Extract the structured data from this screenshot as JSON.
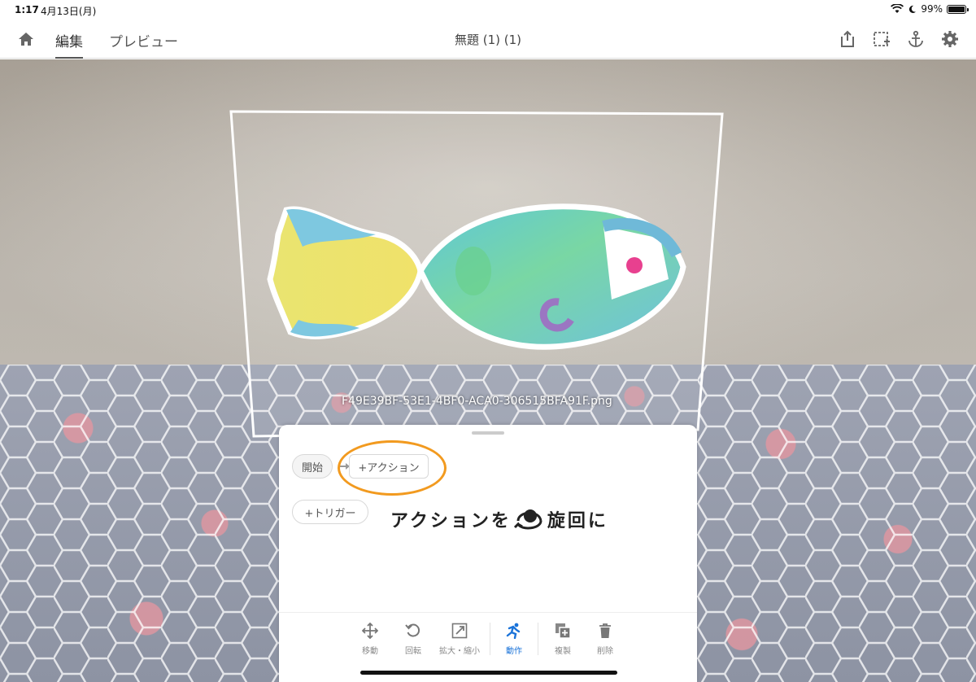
{
  "status_bar": {
    "time": "1:17",
    "date": "4月13日(月)",
    "battery": "99%",
    "battery_level": 0.99,
    "icons": [
      "wifi-icon",
      "moon-icon",
      "battery-icon"
    ]
  },
  "nav": {
    "home_icon": "home-icon",
    "tabs": [
      {
        "label": "編集",
        "active": true
      },
      {
        "label": "プレビュー",
        "active": false
      }
    ],
    "title": "無題 (1) (1)",
    "right_icons": [
      "share-icon",
      "add-frame-icon",
      "anchor-icon",
      "gear-icon"
    ]
  },
  "scene": {
    "filename": "F49E39BF-53E1-4BF0-ACA0-306515BFA91F.png"
  },
  "sheet": {
    "start_label": "開始",
    "action_label": "+アクション",
    "trigger_label": "+トリガー",
    "caption_before": "アクションを",
    "caption_after": "旋回に",
    "toolbar": [
      {
        "label": "移動",
        "icon": "move-icon",
        "active": false
      },
      {
        "label": "回転",
        "icon": "rotate-icon",
        "active": false
      },
      {
        "label": "拡大・縮小",
        "icon": "scale-icon",
        "active": false
      },
      {
        "label": "動作",
        "icon": "run-icon",
        "active": true
      },
      {
        "label": "複製",
        "icon": "duplicate-icon",
        "active": false
      },
      {
        "label": "削除",
        "icon": "trash-icon",
        "active": false
      }
    ]
  },
  "colors": {
    "accent": "#1a73d9",
    "highlight": "#f29a1f"
  }
}
